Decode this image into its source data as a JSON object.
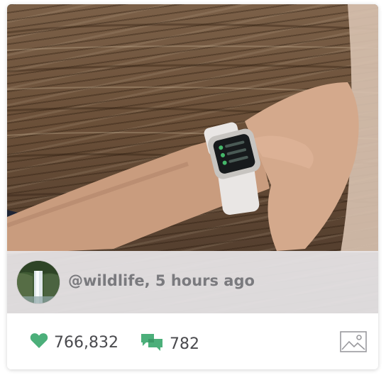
{
  "post": {
    "author_line": "@wildlife, 5 hours ago",
    "likes": "766,832",
    "comments": "782"
  },
  "icons": {
    "likes": "heart-icon",
    "comments": "speech-bubbles-icon",
    "media_type": "image-icon"
  },
  "colors": {
    "accent": "#4caf7a",
    "text_muted": "#7a7a7e",
    "text_dark": "#4a4a4e"
  }
}
